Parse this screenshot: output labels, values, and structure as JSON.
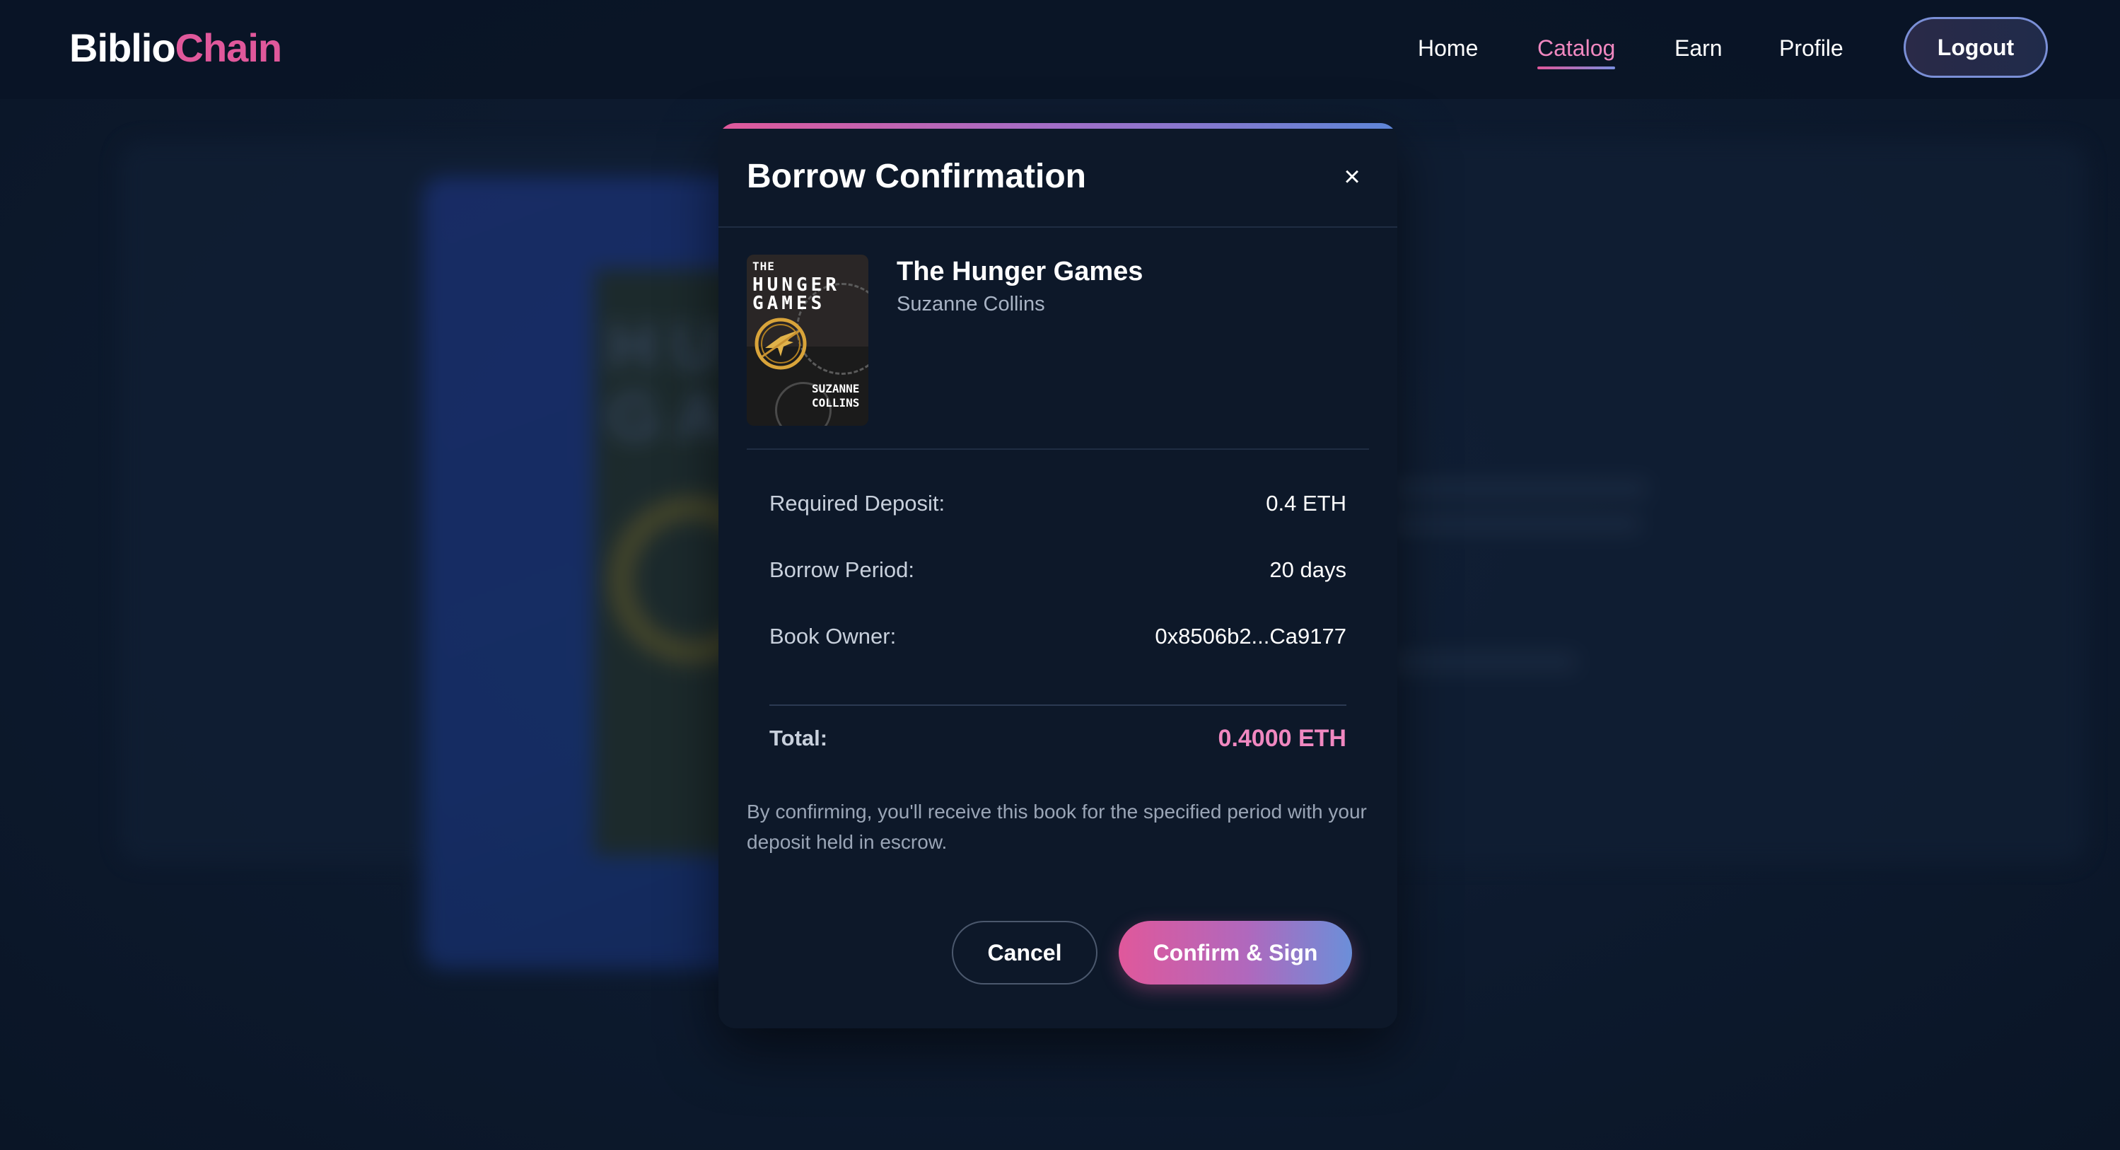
{
  "brand": {
    "part1": "Biblio",
    "part2": "Chain",
    "part2_color": "#e0589b"
  },
  "nav": {
    "items": [
      {
        "label": "Home",
        "active": false
      },
      {
        "label": "Catalog",
        "active": true
      },
      {
        "label": "Earn",
        "active": false
      },
      {
        "label": "Profile",
        "active": false
      }
    ],
    "logout_label": "Logout"
  },
  "modal": {
    "title": "Borrow Confirmation",
    "close_icon": "close-icon",
    "book": {
      "title": "The Hunger Games",
      "author": "Suzanne Collins",
      "cover": {
        "line1": "THE",
        "line2": "HUNGER",
        "line3": "GAMES",
        "author_line1": "SUZANNE",
        "author_line2": "COLLINS"
      }
    },
    "details": [
      {
        "label": "Required Deposit:",
        "value": "0.4 ETH"
      },
      {
        "label": "Borrow Period:",
        "value": "20 days"
      },
      {
        "label": "Book Owner:",
        "value": "0x8506b2...Ca9177"
      }
    ],
    "total": {
      "label": "Total:",
      "value": "0.4000 ETH",
      "color": "#f088c0"
    },
    "disclaimer": "By confirming, you'll receive this book for the specified period with your deposit held in escrow.",
    "cancel_label": "Cancel",
    "confirm_label": "Confirm & Sign"
  },
  "colors": {
    "background": "#0b1628",
    "accent_pink": "#e0589b",
    "accent_blue": "#6b8fd9",
    "modal_bg": "#0d1829"
  }
}
